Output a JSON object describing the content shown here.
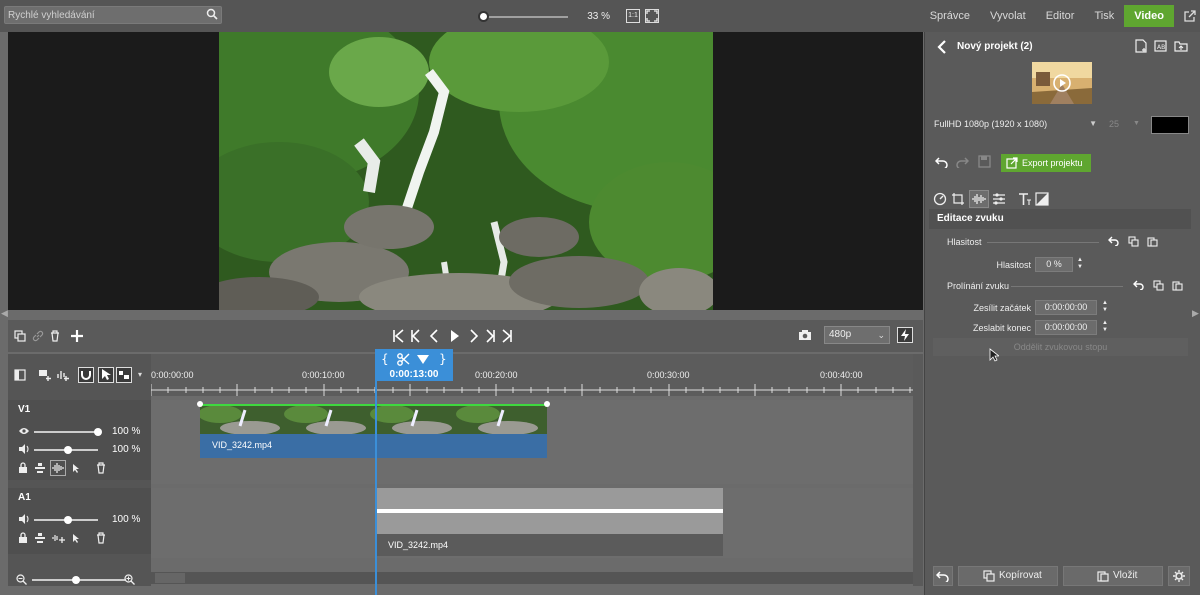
{
  "search": {
    "placeholder": "Rychlé vyhledávání"
  },
  "zoom": {
    "value": "33 %",
    "fit_1_1": "1:1"
  },
  "modules": [
    "Správce",
    "Vyvolat",
    "Editor",
    "Tisk",
    "Video"
  ],
  "timeline": {
    "ruler_labels": [
      "0:00:00:00",
      "0:00:10:00",
      "0:00:20:00",
      "0:00:30:00",
      "0:00:40:00"
    ],
    "playhead_time": "0:00:13:00",
    "resolution": "480p",
    "tracks": {
      "v1": {
        "name": "V1",
        "opacity": "100 %",
        "volume": "100 %",
        "clip": "VID_3242.mp4"
      },
      "a1": {
        "name": "A1",
        "volume": "100 %",
        "clip": "VID_3242.mp4"
      }
    }
  },
  "panel": {
    "project_title": "Nový projekt (2)",
    "format": "FullHD 1080p (1920 x 1080)",
    "fps": "25",
    "export_label": "Export projektu",
    "section_title": "Editace zvuku",
    "volume_group": "Hlasitost",
    "volume_label": "Hlasitost",
    "volume_value": "0 %",
    "fade_group": "Prolínání zvuku",
    "fade_in_label": "Zesílit začátek",
    "fade_in_value": "0:00:00:00",
    "fade_out_label": "Zeslabit konec",
    "fade_out_value": "0:00:00:00",
    "split_label": "Oddělit zvukovou stopu",
    "copy_label": "Kopírovat",
    "paste_label": "Vložit"
  },
  "colors": {
    "accent": "#5fa630",
    "playhead": "#3b8fd8",
    "clip_video": "#3a6ea5"
  }
}
